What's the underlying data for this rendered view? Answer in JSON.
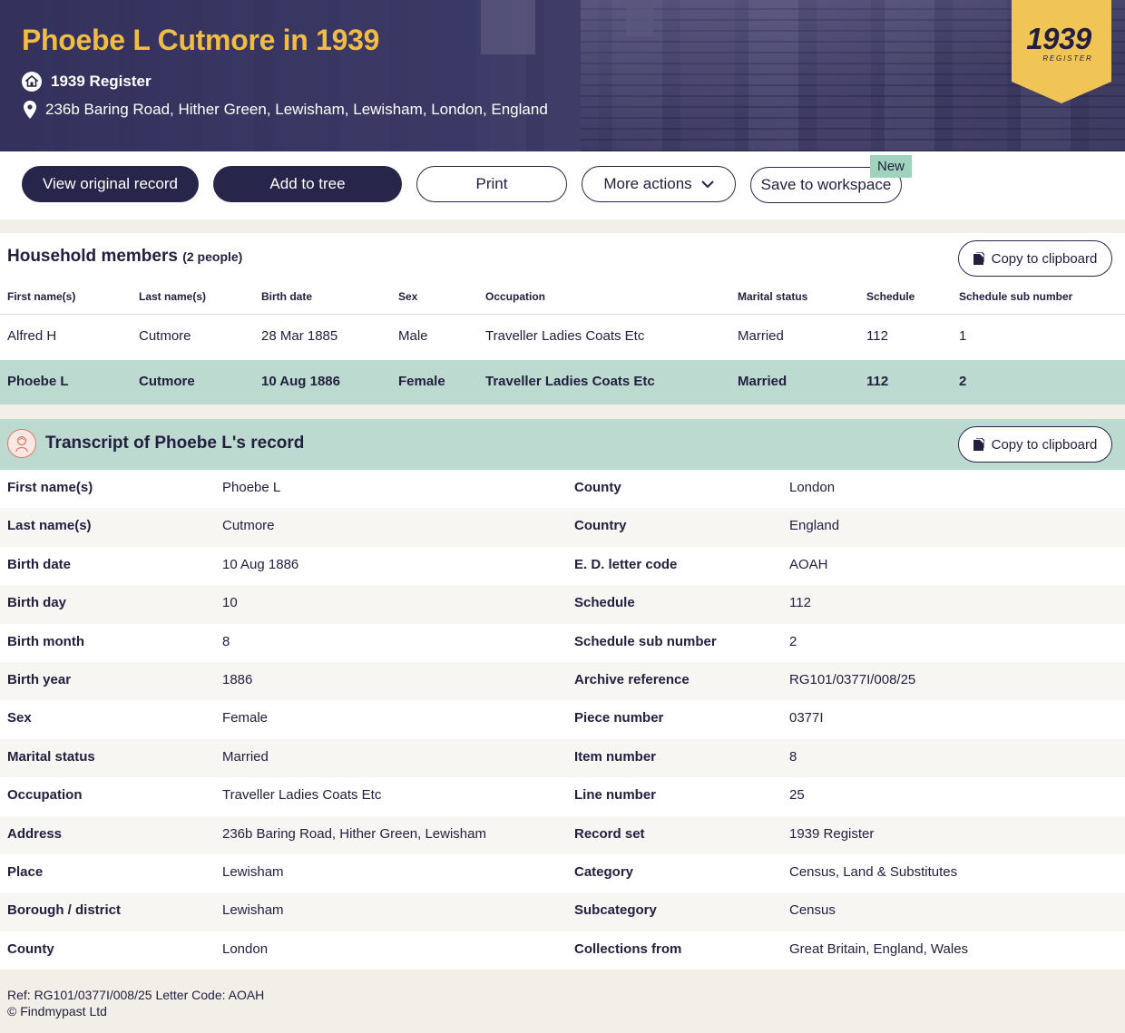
{
  "hero": {
    "title": "Phoebe L Cutmore in 1939",
    "record_set": "1939 Register",
    "address": "236b Baring Road, Hither Green, Lewisham, Lewisham, London, England",
    "badge_year": "1939",
    "badge_sub": "REGISTER"
  },
  "actions": {
    "view_original": "View original record",
    "add_to_tree": "Add to tree",
    "print": "Print",
    "more_actions": "More actions",
    "save_workspace": "Save to workspace",
    "new_tag": "New"
  },
  "household": {
    "title": "Household members",
    "count": "(2 people)",
    "copy_label": "Copy to clipboard",
    "columns": [
      "First name(s)",
      "Last name(s)",
      "Birth date",
      "Sex",
      "Occupation",
      "Marital status",
      "Schedule",
      "Schedule sub number"
    ],
    "rows": [
      [
        "Alfred H",
        "Cutmore",
        "28 Mar 1885",
        "Male",
        "Traveller Ladies Coats Etc",
        "Married",
        "112",
        "1"
      ],
      [
        "Phoebe L",
        "Cutmore",
        "10 Aug 1886",
        "Female",
        "Traveller Ladies Coats Etc",
        "Married",
        "112",
        "2"
      ]
    ]
  },
  "transcript": {
    "title": "Transcript of Phoebe L's record",
    "copy_label": "Copy to clipboard",
    "rows": [
      [
        "First name(s)",
        "Phoebe L",
        "County",
        "London"
      ],
      [
        "Last name(s)",
        "Cutmore",
        "Country",
        "England"
      ],
      [
        "Birth date",
        "10 Aug 1886",
        "E. D. letter code",
        "AOAH"
      ],
      [
        "Birth day",
        "10",
        "Schedule",
        "112"
      ],
      [
        "Birth month",
        "8",
        "Schedule sub number",
        "2"
      ],
      [
        "Birth year",
        "1886",
        "Archive reference",
        "RG101/0377I/008/25"
      ],
      [
        "Sex",
        "Female",
        "Piece number",
        "0377I"
      ],
      [
        "Marital status",
        "Married",
        "Item number",
        "8"
      ],
      [
        "Occupation",
        "Traveller Ladies Coats Etc",
        "Line number",
        "25"
      ],
      [
        "Address",
        "236b Baring Road, Hither Green, Lewisham",
        "Record set",
        "1939 Register"
      ],
      [
        "Place",
        "Lewisham",
        "Category",
        "Census, Land & Substitutes"
      ],
      [
        "Borough / district",
        "Lewisham",
        "Subcategory",
        "Census"
      ],
      [
        "County",
        "London",
        "Collections from",
        "Great Britain, England, Wales"
      ]
    ]
  },
  "footer": {
    "ref": "Ref: RG101/0377I/008/25 Letter Code: AOAH",
    "copyright": "© Findmypast Ltd"
  },
  "colors": {
    "navy": "#28254a",
    "gold": "#f0bc46",
    "mint": "#bcdad0",
    "new_tag": "#9fd3bd"
  }
}
